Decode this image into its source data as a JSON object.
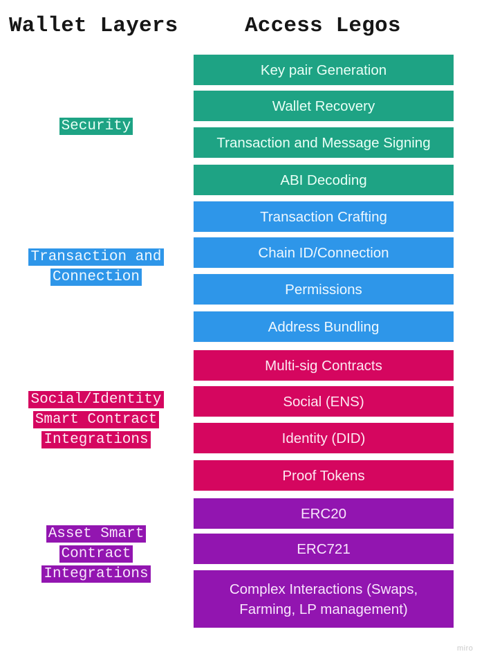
{
  "headings": {
    "left": "Wallet Layers",
    "right": "Access Legos"
  },
  "colors": {
    "security": "#1ea384",
    "transaction": "#2e96e9",
    "social": "#d5065f",
    "asset": "#9215b0"
  },
  "layers": [
    {
      "id": "security",
      "label_lines": [
        "Security"
      ],
      "legos": [
        "Key pair Generation",
        "Wallet Recovery",
        "Transaction and Message Signing",
        "ABI Decoding"
      ]
    },
    {
      "id": "transaction",
      "label_lines": [
        "Transaction and",
        "Connection"
      ],
      "legos": [
        "Transaction Crafting",
        "Chain ID/Connection",
        "Permissions",
        "Address Bundling"
      ]
    },
    {
      "id": "social",
      "label_lines": [
        "Social/Identity",
        "Smart Contract",
        "Integrations"
      ],
      "legos": [
        "Multi-sig Contracts",
        "Social (ENS)",
        "Identity (DID)",
        "Proof Tokens"
      ]
    },
    {
      "id": "asset",
      "label_lines": [
        "Asset Smart",
        "Contract",
        "Integrations"
      ],
      "legos": [
        "ERC20",
        "ERC721",
        "Complex Interactions (Swaps, Farming, LP management)"
      ]
    }
  ],
  "watermark": "miro"
}
